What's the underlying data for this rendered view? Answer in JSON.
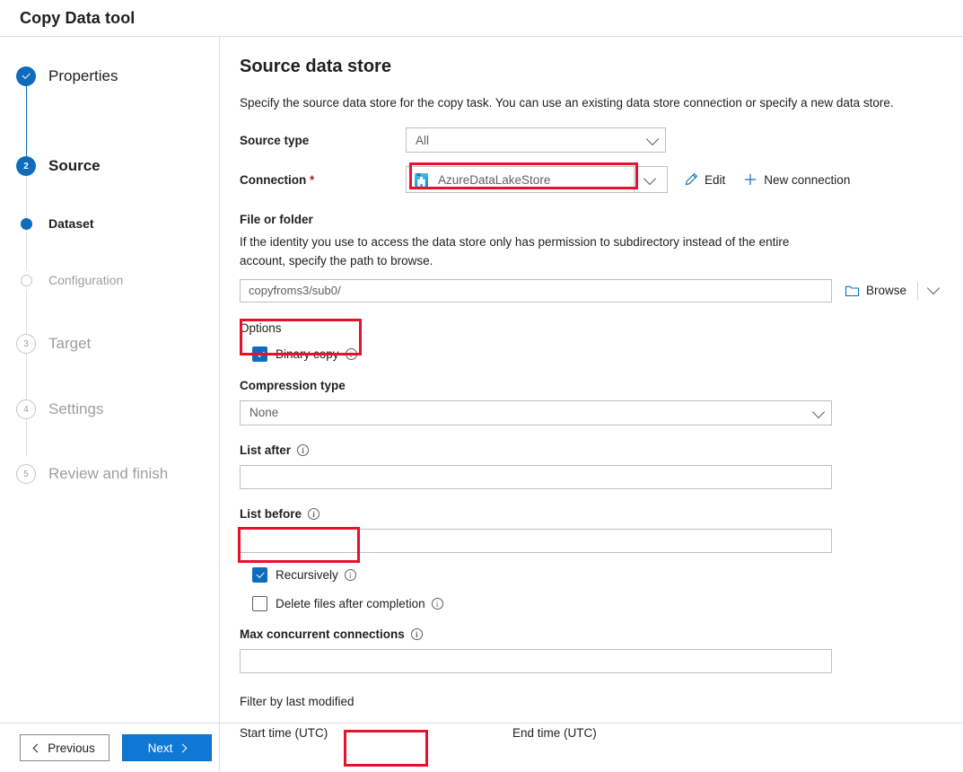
{
  "header": {
    "title": "Copy Data tool"
  },
  "stepper": {
    "steps": [
      {
        "id": "properties",
        "label": "Properties",
        "marker": "check",
        "state": "done",
        "level": 1
      },
      {
        "id": "source",
        "label": "Source",
        "marker": "2",
        "state": "current",
        "level": 1
      },
      {
        "id": "dataset",
        "label": "Dataset",
        "marker": "dot",
        "state": "active",
        "level": 2
      },
      {
        "id": "configuration",
        "label": "Configuration",
        "marker": "circle",
        "state": "upcoming",
        "level": 2
      },
      {
        "id": "target",
        "label": "Target",
        "marker": "3",
        "state": "upcoming",
        "level": 1
      },
      {
        "id": "settings",
        "label": "Settings",
        "marker": "4",
        "state": "upcoming",
        "level": 1
      },
      {
        "id": "review",
        "label": "Review and finish",
        "marker": "5",
        "state": "upcoming",
        "level": 1
      }
    ]
  },
  "main": {
    "title": "Source data store",
    "description": "Specify the source data store for the copy task. You can use an existing data store connection or specify a new data store.",
    "source_type": {
      "label": "Source type",
      "value": "All"
    },
    "connection": {
      "label": "Connection",
      "required_marker": "*",
      "value": "AzureDataLakeStore",
      "icon": "azure-data-lake-store-icon",
      "edit_label": "Edit",
      "new_connection_label": "New connection"
    },
    "file_or_folder": {
      "title": "File or folder",
      "help": "If the identity you use to access the data store only has permission to subdirectory instead of the entire account, specify the path to browse.",
      "value": "copyfroms3/sub0/",
      "browse_label": "Browse"
    },
    "options": {
      "title": "Options",
      "binary_copy": {
        "label": "Binary copy",
        "checked": true
      },
      "compression_type": {
        "label": "Compression type",
        "value": "None"
      },
      "list_after": {
        "label": "List after",
        "value": ""
      },
      "list_before": {
        "label": "List before",
        "value": ""
      },
      "recursively": {
        "label": "Recursively",
        "checked": true
      },
      "delete_files": {
        "label": "Delete files after completion",
        "checked": false
      },
      "max_concurrent_connections": {
        "label": "Max concurrent connections",
        "value": ""
      }
    },
    "filter": {
      "title": "Filter by last modified",
      "start_time_label": "Start time (UTC)",
      "end_time_label": "End time (UTC)"
    }
  },
  "footer": {
    "previous_label": "Previous",
    "next_label": "Next"
  },
  "colors": {
    "accent": "#0f6cbd",
    "primary_button": "#0f78d4",
    "annotation": "#e8112d",
    "required": "#a4262c",
    "muted": "#a19f9d"
  }
}
